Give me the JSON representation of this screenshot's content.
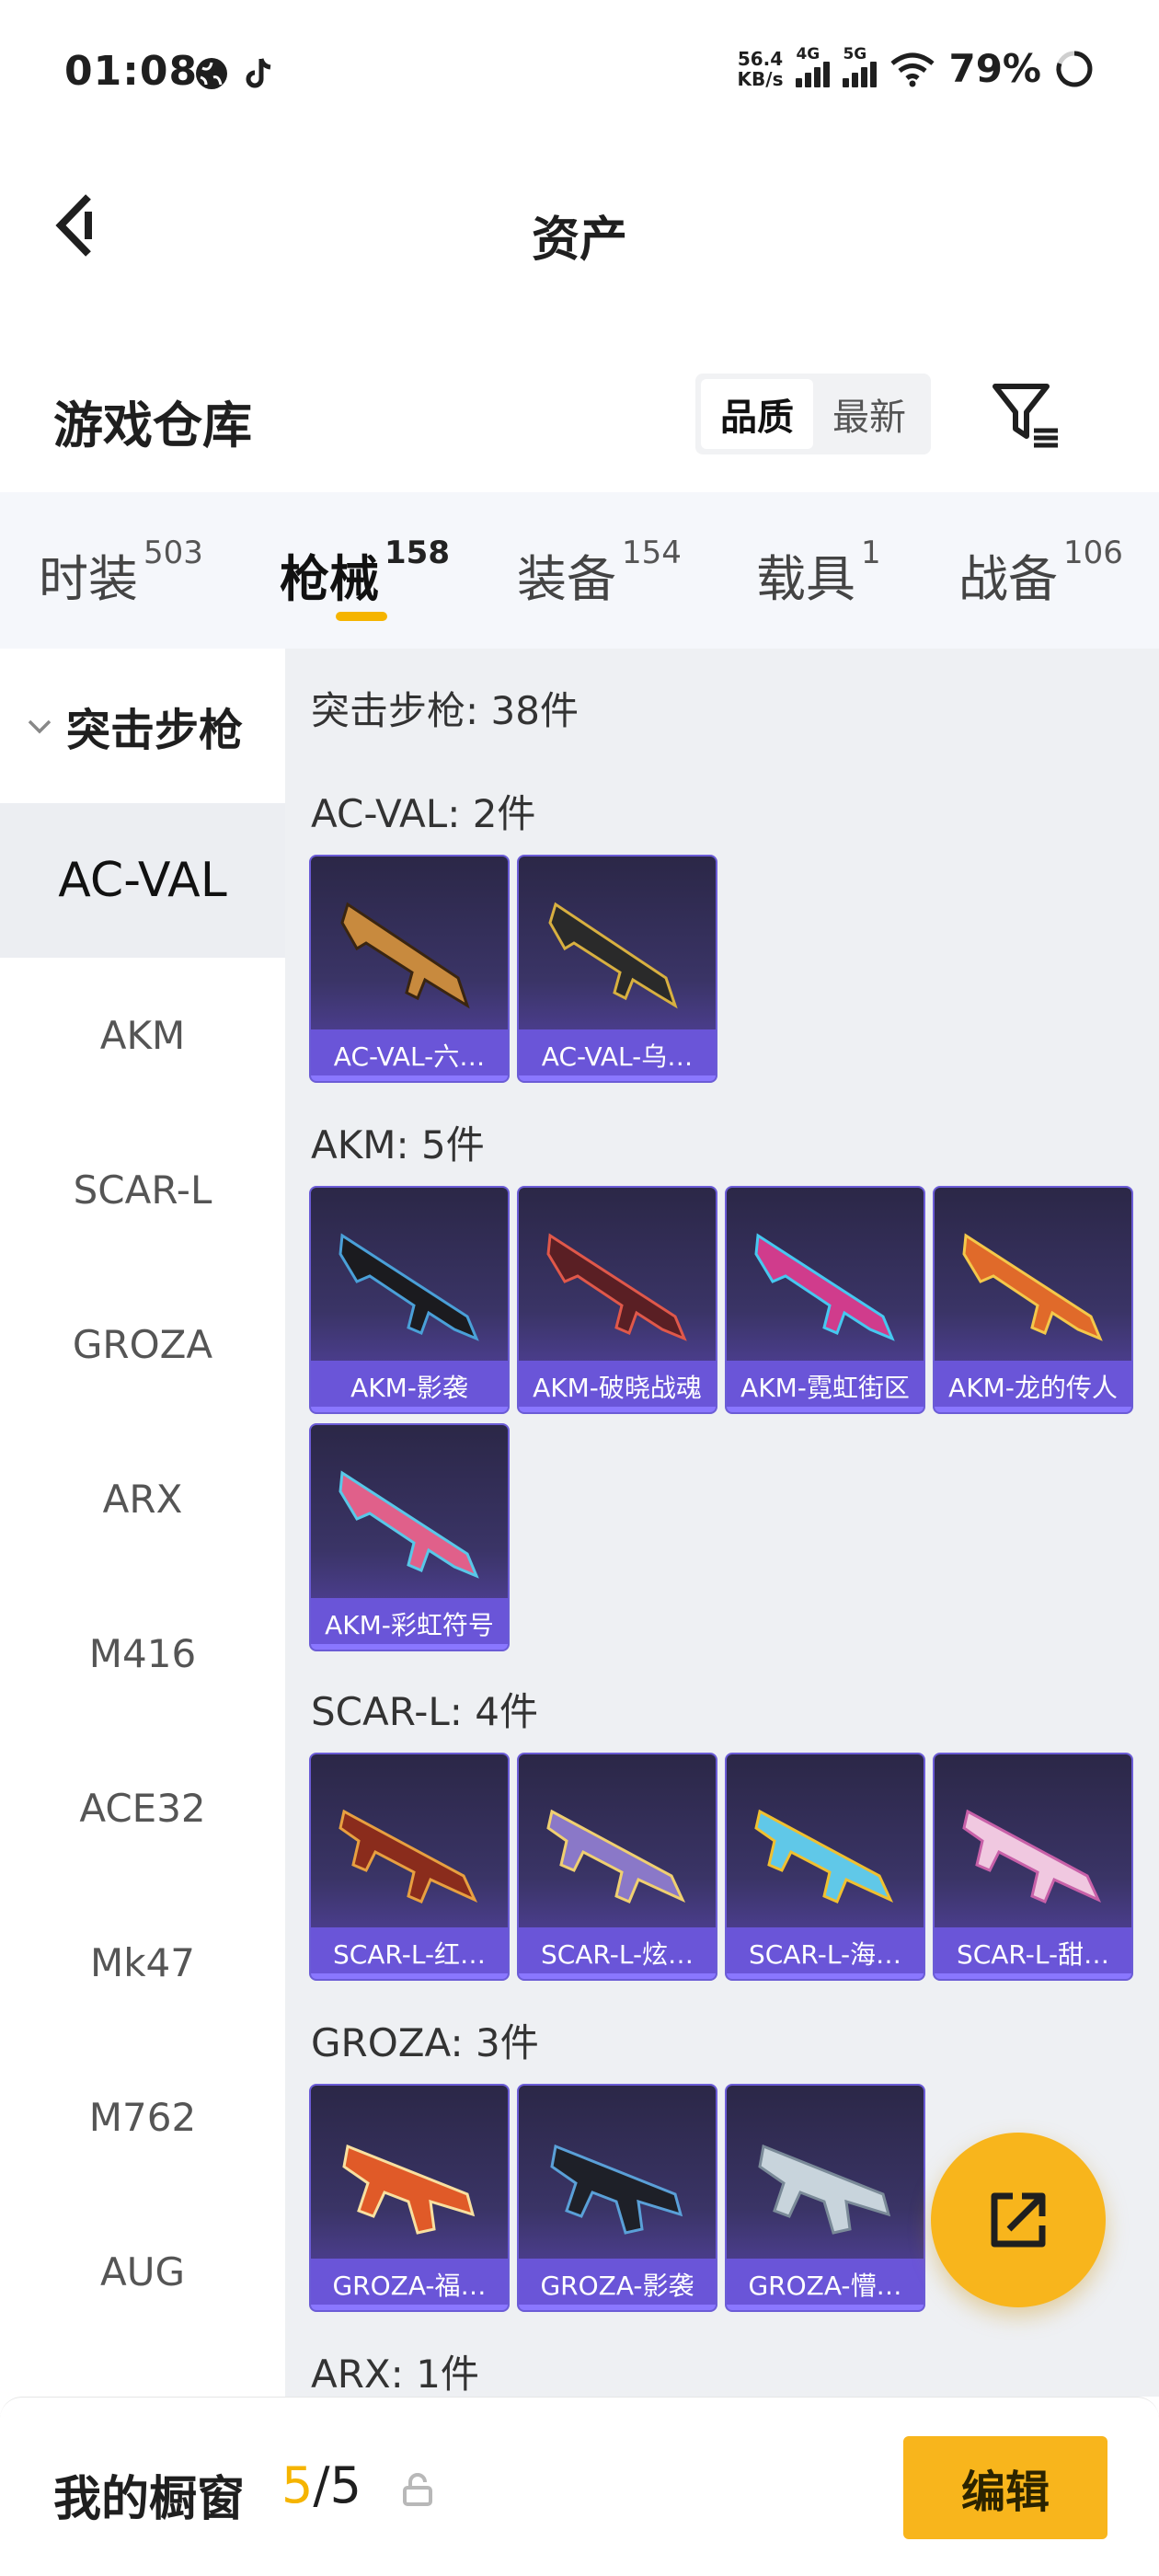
{
  "status_bar": {
    "time": "01:08",
    "net_speed_value": "56.4",
    "net_speed_unit": "KB/s",
    "sig1_label": "4G",
    "sig2_label": "5G",
    "battery": "79%"
  },
  "header": {
    "title": "资产"
  },
  "warehouse": {
    "title": "游戏仓库",
    "sort_options": [
      "品质",
      "最新"
    ],
    "active_sort": "品质"
  },
  "category_tabs": [
    {
      "label": "时装",
      "count": "503"
    },
    {
      "label": "枪械",
      "count": "158",
      "active": true
    },
    {
      "label": "装备",
      "count": "154"
    },
    {
      "label": "载具",
      "count": "1"
    },
    {
      "label": "战备",
      "count": "106"
    }
  ],
  "sidebar": {
    "group": "突击步枪",
    "items": [
      "AC-VAL",
      "AKM",
      "SCAR-L",
      "GROZA",
      "ARX",
      "M416",
      "ACE32",
      "Mk47",
      "M762",
      "AUG"
    ],
    "active": "AC-VAL"
  },
  "content": {
    "total_label": "突击步枪: 38件",
    "sections": [
      {
        "label": "AC-VAL: 2件",
        "items": [
          "AC-VAL-六…",
          "AC-VAL-乌…"
        ]
      },
      {
        "label": "AKM: 5件",
        "items": [
          "AKM-影袭",
          "AKM-破晓战魂",
          "AKM-霓虹街区",
          "AKM-龙的传人",
          "AKM-彩虹符号"
        ]
      },
      {
        "label": "SCAR-L: 4件",
        "items": [
          "SCAR-L-红…",
          "SCAR-L-炫…",
          "SCAR-L-海…",
          "SCAR-L-甜…"
        ]
      },
      {
        "label": "GROZA: 3件",
        "items": [
          "GROZA-福…",
          "GROZA-影袭",
          "GROZA-懵…"
        ]
      },
      {
        "label": "ARX: 1件",
        "items": []
      }
    ]
  },
  "bottom_bar": {
    "title": "我的橱窗",
    "current": "5",
    "separator": "/",
    "max": "5",
    "edit_label": "编辑"
  },
  "colors": {
    "accent": "#f8b51c",
    "card_label": "#6a55d8",
    "card_bg": "#2b2747"
  }
}
